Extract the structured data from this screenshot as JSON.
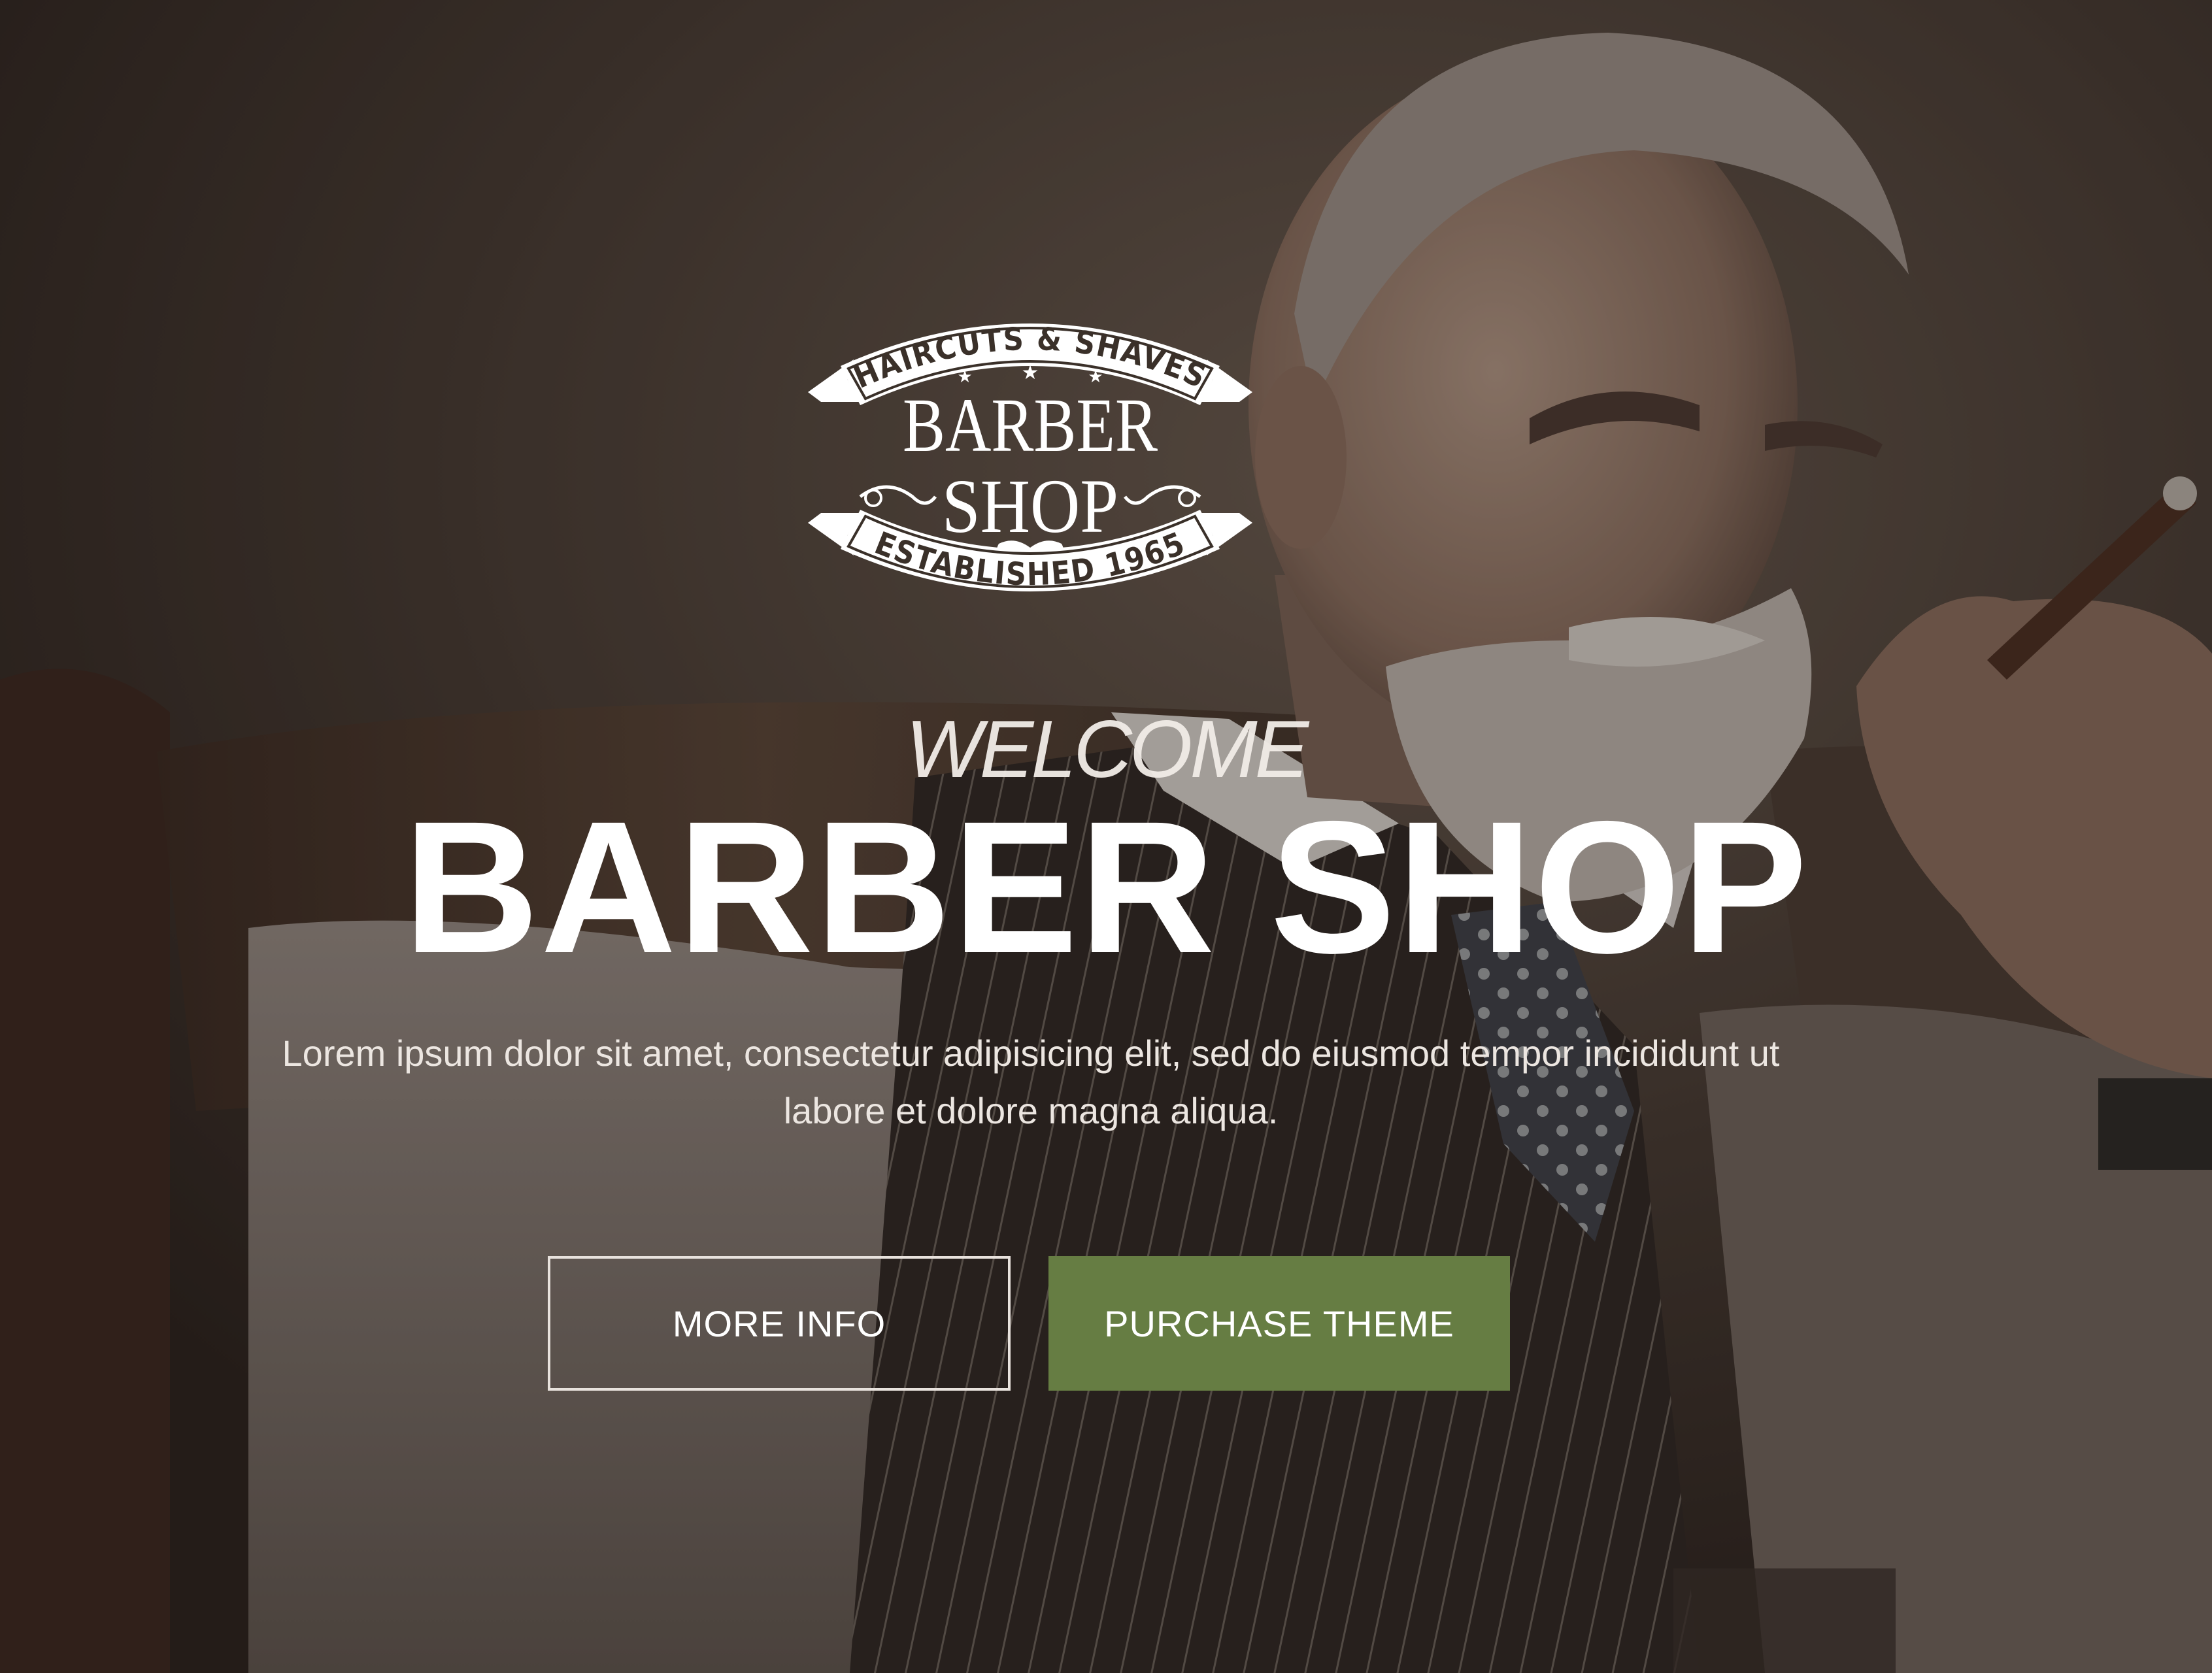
{
  "logo": {
    "top_ribbon": "HAIRCUTS & SHAVES",
    "line1": "BARBER",
    "line2": "SHOP",
    "bottom_ribbon": "ESTABLISHED 1965",
    "icon": "mustache-icon"
  },
  "hero": {
    "welcome": "WELCOME",
    "title": "BARBER SHOP",
    "lead": "Lorem ipsum dolor sit amet, consectetur adipisicing elit, sed do eiusmod tempor incididunt ut labore et dolore magna aliqua."
  },
  "buttons": {
    "more_info": "MORE INFO",
    "purchase": "PURCHASE THEME"
  },
  "colors": {
    "accent": "#667d43",
    "text": "#ffffff"
  }
}
